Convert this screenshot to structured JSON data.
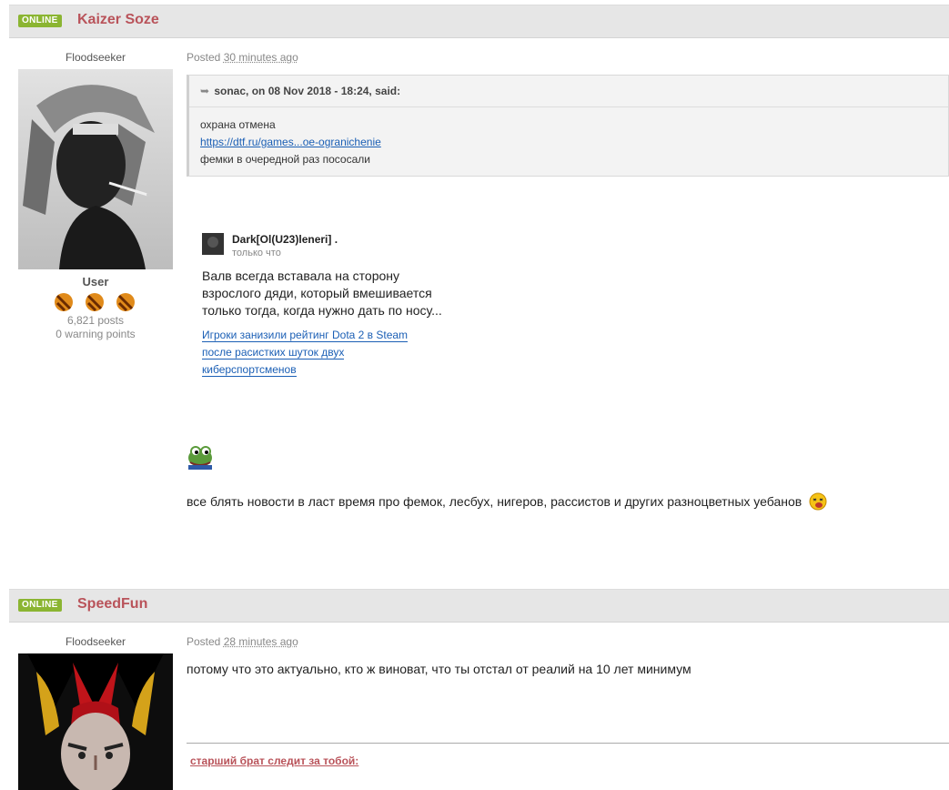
{
  "posts": [
    {
      "status": "ONLINE",
      "author": "Kaizer Soze",
      "rank_title": "Floodseeker",
      "group": "User",
      "posts_count": "6,821 posts",
      "warning_points": "0 warning points",
      "posted_label": "Posted",
      "posted_ago": "30 minutes ago",
      "quote": {
        "citation": "sonac, on 08 Nov 2018 - 18:24, said:",
        "line1": "охрана отмена",
        "link": "https://dtf.ru/games...oe-ogranichenie",
        "line3": "фемки в очередной раз пососали"
      },
      "embed": {
        "author": "Dark[Ol(U23)leneri] .",
        "time": "только что",
        "text": "Валв всегда вставала на сторону взрослого дяди, который вмешивается только тогда, когда нужно дать по носу...",
        "link_text": "Игроки занизили рейтинг Dota 2 в Steam после расистких шуток двух киберспортсменов"
      },
      "body_text": "все блять новости в ласт время про фемок, лесбух, нигеров, рассистов и других разноцветных уебанов"
    },
    {
      "status": "ONLINE",
      "author": "SpeedFun",
      "rank_title": "Floodseeker",
      "posted_label": "Posted",
      "posted_ago": "28 minutes ago",
      "body_text": "потому что это актуально, кто ж виноват, что ты отстал от реалий на 10 лет минимум",
      "signature_link": "старший брат следит за тобой:"
    }
  ]
}
